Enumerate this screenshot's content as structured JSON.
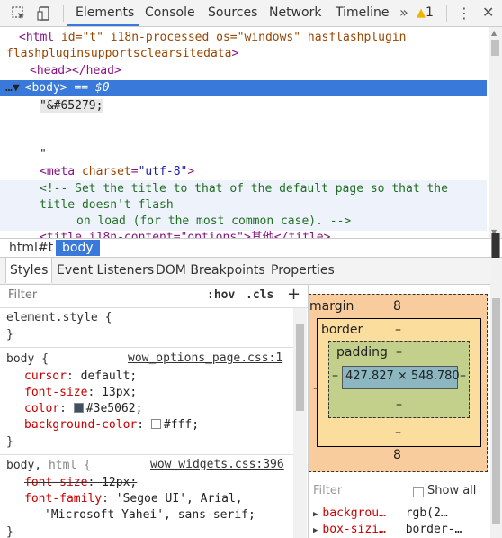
{
  "toolbar": {
    "tabs": [
      "Elements",
      "Console",
      "Sources",
      "Network",
      "Timeline"
    ],
    "more": "»",
    "warnings": "1",
    "kebab": "⋮",
    "close": "✕"
  },
  "dom_tree": {
    "html_open": {
      "tag": "<html",
      "attrs": " id=\"t\" i18n-processed os=\"windows\" hasflashplugin",
      "attrs2": "flashpluginsupportsclearsitedata",
      "close": ">"
    },
    "head": "<head></head>",
    "body_prefix": "…▼",
    "body_tag": "<body>",
    "body_suffix": " == $0",
    "text1": "\"&#65279;",
    "text2": "\"",
    "meta": {
      "open": "<meta",
      "attr": " charset",
      "eq": "=",
      "val": "\"utf-8\"",
      "close": ">"
    },
    "comment1": "<!-- Set the title to that of the default page so that the",
    "comment2": "title doesn't flash",
    "comment3": "on load (for the most common case). -->",
    "title_line": "<title i18n-content=\"options\">其他</title>"
  },
  "breadcrumb": [
    "html#t",
    "body"
  ],
  "styles_tabs": [
    "Styles",
    "Event Listeners",
    "DOM Breakpoints",
    "Properties"
  ],
  "styles": {
    "filter_placeholder": "Filter",
    "hov": ":hov",
    "cls": ".cls",
    "add": "+",
    "element_style": "element.style {",
    "brace_close": "}",
    "rule1": {
      "selector": "body {",
      "source": "wow_options_page.css:1",
      "props": [
        {
          "name": "cursor",
          "value": "default;"
        },
        {
          "name": "font-size",
          "value": "13px;"
        },
        {
          "name": "color",
          "value": "#3e5062;",
          "swatch": "#3e5062"
        },
        {
          "name": "background-color",
          "value": "#fff;",
          "swatch": "#ffffff"
        }
      ]
    },
    "rule2": {
      "selector_a": "body, ",
      "selector_b": "html {",
      "source": "wow_widgets.css:396",
      "props": [
        {
          "name": "font-size",
          "value": "12px;",
          "struck": true
        },
        {
          "name": "font-family",
          "value": "'Segoe UI', Arial,"
        },
        {
          "name": "",
          "value": "'Microsoft Yahei', sans-serif;"
        }
      ]
    }
  },
  "box_model": {
    "margin_label": "margin",
    "margin_top": "8",
    "margin_bottom": "8",
    "margin_left": "–",
    "margin_right": "–",
    "border_label": "border",
    "border_top": "–",
    "border_bottom": "–",
    "padding_label": "padding",
    "padding_top": "–",
    "padding_bottom": "–",
    "padding_left": "–",
    "padding_right": "–",
    "content": "427.827 × 548.780"
  },
  "computed": {
    "filter_placeholder": "Filter",
    "show_all": "Show all",
    "rows": [
      {
        "name": "backgrou…",
        "value": "rgb(2…"
      },
      {
        "name": "box-sizi…",
        "value": "border-…"
      }
    ]
  }
}
